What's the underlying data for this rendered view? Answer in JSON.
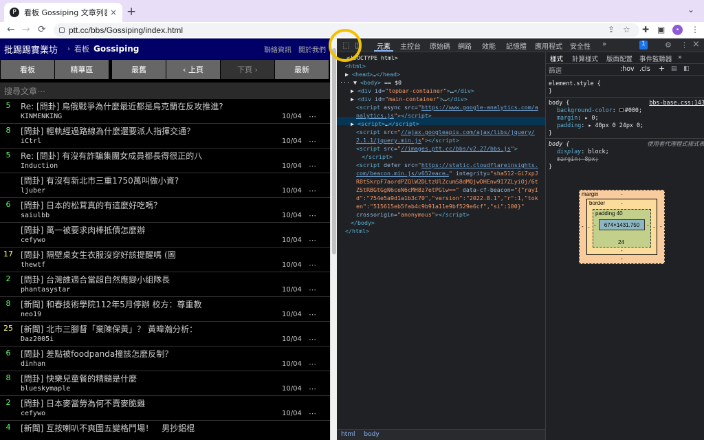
{
  "browser": {
    "tab_title": "看板 Gossiping 文章列表 - 批踢",
    "favicon_glyph": "P",
    "tab_close": "×",
    "new_tab": "+",
    "tab_dropdown": "⌄",
    "url": "ptt.cc/bbs/Gossiping/index.html",
    "back": "←",
    "forward": "→",
    "reload": "⟳",
    "share": "⇪",
    "star": "☆",
    "extensions": "✚",
    "sidebar": "▣",
    "avatar_glyph": "•",
    "menu": "⋮"
  },
  "ptt": {
    "logo": "批踢踢實業坊",
    "crumb_arrow": "›",
    "crumb_board": "看板",
    "board_name": "Gossiping",
    "top_links": "聯絡資訊　關於我們",
    "buttons": [
      "看板",
      "精華區",
      "最舊",
      "‹ 上頁",
      "下頁 ›",
      "最新"
    ],
    "search_placeholder": "搜尋文章⋯",
    "more_glyph": "⋯",
    "posts": [
      {
        "nrec": "5",
        "color": "#66ff66",
        "title": "Re: [問卦] 烏俄戰爭為什麼最近都是烏克蘭在反攻推進?",
        "author": "KINMENKING",
        "date": "10/04"
      },
      {
        "nrec": "8",
        "color": "#66ff66",
        "title": "[問卦] 輕軌經過路線為什麼還要派人指揮交通？",
        "author": "iCtrl",
        "date": "10/04"
      },
      {
        "nrec": "5",
        "color": "#66ff66",
        "title": "Re: [問卦] 有沒有詐騙集團女成員都長得很正的八",
        "author": "Induction",
        "date": "10/04"
      },
      {
        "nrec": "",
        "color": "#66ff66",
        "title": "[問卦] 有沒有新北市三重1750萬叫做小資?",
        "author": "ljuber",
        "date": "10/04"
      },
      {
        "nrec": "6",
        "color": "#66ff66",
        "title": "[問卦] 日本的松茸真的有這麼好吃嗎？",
        "author": "saiulbb",
        "date": "10/04"
      },
      {
        "nrec": "",
        "color": "#66ff66",
        "title": "[問卦] 萬一被要求肉棒抵債怎麼辦",
        "author": "cefywo",
        "date": "10/04"
      },
      {
        "nrec": "17",
        "color": "#ffff66",
        "title": "[問卦] 隔壁桌女生衣服沒穿好該提醒嗎 (圖",
        "author": "thewtf",
        "date": "10/04"
      },
      {
        "nrec": "2",
        "color": "#66ff66",
        "title": "[問卦] 台灣誰適合當超自然應變小組隊長",
        "author": "phantasystar",
        "date": "10/04"
      },
      {
        "nrec": "8",
        "color": "#66ff66",
        "title": "[新聞] 和春技術學院112年5月停辦 校方：尊重教",
        "author": "neo19",
        "date": "10/04"
      },
      {
        "nrec": "25",
        "color": "#ffff66",
        "title": "[新聞] 北市三腳督「棄陳保黃」？ 黃暐瀚分析：",
        "author": "Daz2005i",
        "date": "10/04"
      },
      {
        "nrec": "6",
        "color": "#66ff66",
        "title": "[問卦] 差點被foodpanda撞該怎麼反制？",
        "author": "dinhan",
        "date": "10/04"
      },
      {
        "nrec": "8",
        "color": "#66ff66",
        "title": "[問卦] 快樂兒童餐的精髓是什麼",
        "author": "blueskymaple",
        "date": "10/04"
      },
      {
        "nrec": "2",
        "color": "#66ff66",
        "title": "[問卦] 日本麥當勞為何不賣麥脆雞",
        "author": "cefywo",
        "date": "10/04"
      },
      {
        "nrec": "4",
        "color": "#66ff66",
        "title": "[新聞] 互按喇叭不爽圍五變格鬥場！　男抄鋁棍",
        "author": "",
        "date": ""
      }
    ]
  },
  "devtools": {
    "inspect_icon": "⬚",
    "device_icon": "▯",
    "tabs": [
      "元素",
      "主控台",
      "原始碼",
      "網路",
      "效能",
      "記憶體",
      "應用程式",
      "安全性"
    ],
    "more_tabs": "»",
    "badge": "1",
    "settings": "⚙",
    "menu": "⋮",
    "close": "×",
    "breadcrumbs": [
      "html",
      "body"
    ]
  },
  "styles": {
    "tabs": [
      "樣式",
      "計算樣式",
      "版面配置",
      "事件監聽器"
    ],
    "more_tabs": "»",
    "filter_placeholder": "篩選",
    "hov": ":hov",
    "cls": ".cls",
    "plus": "+",
    "element_style": "element.style {",
    "close_brace": "}",
    "rule1_selector": "body {",
    "rule1_source": "bbs-base.css:143",
    "rule1_props": [
      {
        "name": "background-color",
        "value": "#000;"
      },
      {
        "name": "margin",
        "value": "▸ 0;"
      },
      {
        "name": "padding",
        "value": "▸ 40px 0 24px 0;"
      }
    ],
    "rule2_selector": "body {",
    "rule2_source": "使用者代理程式樣式表",
    "rule2_props": [
      {
        "name": "display",
        "value": "block;"
      },
      {
        "name": "margin",
        "value": "8px;"
      }
    ],
    "box_model": {
      "margin_label": "margin",
      "margin_top": "-",
      "margin_bottom": "-",
      "margin_left": "-",
      "margin_right": "-",
      "border_label": "border",
      "border_top": "-",
      "border_bottom": "-",
      "border_left": "-",
      "border_right": "-",
      "padding_label": "padding 40",
      "padding_bottom": "24",
      "padding_left": "-",
      "padding_right": "-",
      "content": "674×1431.750"
    }
  },
  "colors": {
    "ptt_topbar": "#000066",
    "devtools_bg": "#202124",
    "tag": "#5db0d7",
    "attr_value": "#f29766",
    "inspect_highlight": "#f2c200"
  }
}
